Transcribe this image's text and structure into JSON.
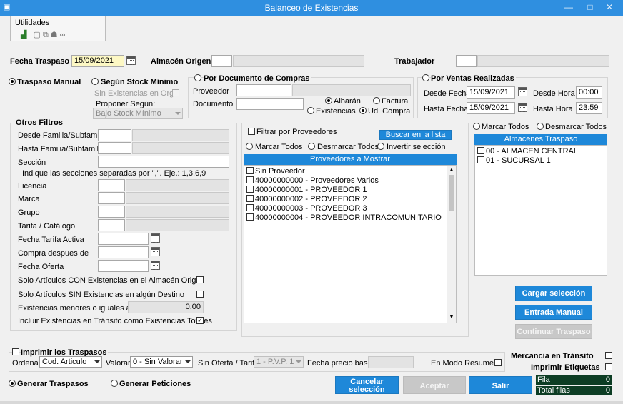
{
  "window": {
    "title": "Balanceo de Existencias"
  },
  "menu": {
    "utilidades": "Utilidades"
  },
  "header": {
    "fecha_traspaso_label": "Fecha Traspaso",
    "fecha_traspaso": "15/09/2021",
    "almacen_origen_label": "Almacén Origen",
    "almacen_origen_code": "",
    "almacen_origen_name": "",
    "trabajador_label": "Trabajador",
    "trabajador_code": "",
    "trabajador_name": ""
  },
  "modes": {
    "traspaso_manual": "Traspaso Manual",
    "segun_stock": "Según Stock Mínimo",
    "sin_existencias_org": "Sin Existencias en Org.",
    "proponer_segun": "Proponer Según:",
    "proponer_value": "Bajo Stock Mínimo",
    "por_documento": "Por Documento de Compras",
    "proveedor_label": "Proveedor",
    "documento_label": "Documento",
    "albaran": "Albarán",
    "factura": "Factura",
    "existencias": "Existencias",
    "ud_compra": "Ud. Compra",
    "por_ventas": "Por Ventas Realizadas",
    "desde_fecha_label": "Desde Fecha",
    "desde_fecha": "15/09/2021",
    "hasta_fecha_label": "Hasta Fecha",
    "hasta_fecha": "15/09/2021",
    "desde_hora_label": "Desde Hora",
    "desde_hora": "00:00",
    "hasta_hora_label": "Hasta Hora",
    "hasta_hora": "23:59"
  },
  "filtros": {
    "title": "Otros Filtros",
    "desde_familia": "Desde Familia/Subfamilia",
    "hasta_familia": "Hasta Familia/Subfamilia",
    "seccion": "Sección",
    "seccion_hint": "Indique las secciones separadas por \",\". Eje.: 1,3,6,9",
    "licencia": "Licencia",
    "marca": "Marca",
    "grupo": "Grupo",
    "tarifa_catalogo": "Tarifa / Catálogo",
    "fecha_tarifa_activa": "Fecha Tarifa Activa",
    "compra_despues_de": "Compra despues de",
    "fecha_oferta": "Fecha Oferta",
    "solo_con_existencias": "Solo Artículos CON Existencias en el Almacén Origen",
    "solo_sin_existencias": "Solo Artículos SIN Existencias en algún Destino",
    "existencias_menores": "Existencias menores o iguales a",
    "existencias_menores_value": "0,00",
    "incluir_transito": "Incluir Existencias en Tránsito como Existencias Totales"
  },
  "proveedores": {
    "filtrar_label": "Filtrar por Proveedores",
    "buscar_button": "Buscar en la lista",
    "marcar_todos": "Marcar Todos",
    "desmarcar_todos": "Desmarcar Todos",
    "invertir": "Invertir selección",
    "header": "Proveedores a Mostrar",
    "items": [
      "Sin Proveedor",
      "40000000000 - Proveedores Varios",
      "40000000001 - PROVEEDOR 1",
      "40000000002 - PROVEEDOR 2",
      "40000000003 - PROVEEDOR 3",
      "40000000004 - PROVEEDOR INTRACOMUNITARIO"
    ]
  },
  "almacenes": {
    "marcar_todos": "Marcar Todos",
    "desmarcar_todos": "Desmarcar Todos",
    "header": "Almacenes Traspaso",
    "items": [
      "00 - ALMACEN CENTRAL",
      "01 - SUCURSAL 1"
    ]
  },
  "actions": {
    "cargar_seleccion": "Cargar selección",
    "entrada_manual": "Entrada Manual",
    "continuar_traspaso": "Continuar Traspaso"
  },
  "bottom": {
    "imprimir_traspasos": "Imprimir los Traspasos",
    "ordenar_label": "Ordenar",
    "ordenar_value": "Cod. Articulo",
    "valorar_label": "Valorar",
    "valorar_value": "0 - Sin Valorar",
    "sin_oferta_label": "Sin Oferta / Tarifa",
    "sin_oferta_value": "1 - P.V.P. 1",
    "fecha_precio_base_label": "Fecha precio base",
    "en_modo_resumen": "En Modo Resumen",
    "mercancia_transito": "Mercancia en Tránsito",
    "imprimir_etiquetas": "Imprimir Etiquetas",
    "generar_traspasos": "Generar Traspasos",
    "generar_peticiones": "Generar Peticiones",
    "cancelar_seleccion": "Cancelar selección",
    "aceptar": "Aceptar",
    "salir": "Salir",
    "fila_activa_label": "Fila activa",
    "fila_activa": "0",
    "total_filas_label": "Total filas",
    "total_filas": "0"
  }
}
